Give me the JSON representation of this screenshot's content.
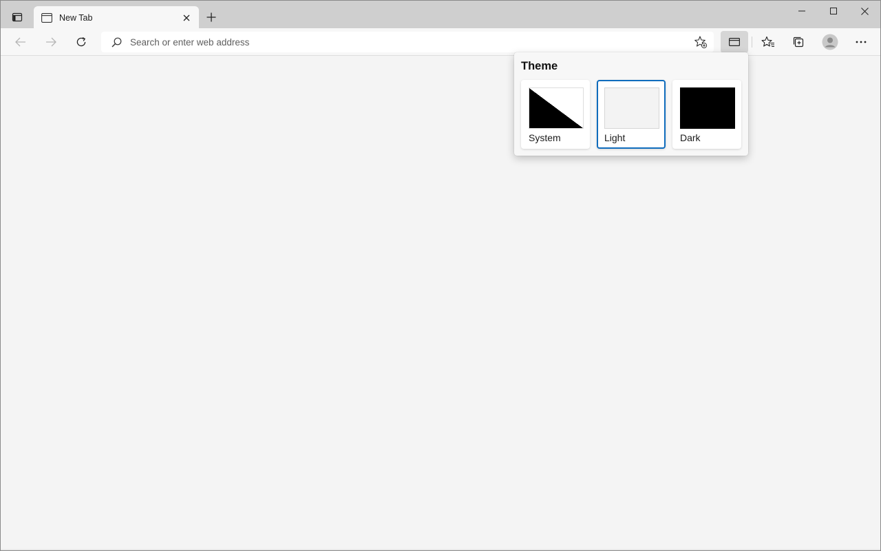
{
  "browser": {
    "tab": {
      "title": "New Tab"
    },
    "address_bar": {
      "placeholder": "Search or enter web address",
      "value": ""
    }
  },
  "theme_flyout": {
    "title": "Theme",
    "options": [
      {
        "label": "System",
        "selected": false
      },
      {
        "label": "Light",
        "selected": true
      },
      {
        "label": "Dark",
        "selected": false
      }
    ]
  },
  "colors": {
    "accent": "#0f6cbd",
    "tabstrip": "#cfcfcf",
    "page_background": "#f4f4f4"
  },
  "icons": {
    "tab_actions": "tab-actions-icon",
    "tab_favicon": "new-tab-page-icon",
    "tab_close": "close-icon",
    "new_tab": "plus-icon",
    "minimize": "minimize-icon",
    "maximize": "maximize-icon",
    "close_window": "close-icon",
    "back": "arrow-left-icon",
    "forward": "arrow-right-icon",
    "refresh": "refresh-icon",
    "search": "search-icon",
    "add_favorite": "star-add-icon",
    "immersive_reader": "window-icon",
    "favorites": "favorites-star-icon",
    "collections": "collections-icon",
    "profile": "profile-avatar-icon",
    "more": "ellipsis-icon"
  }
}
